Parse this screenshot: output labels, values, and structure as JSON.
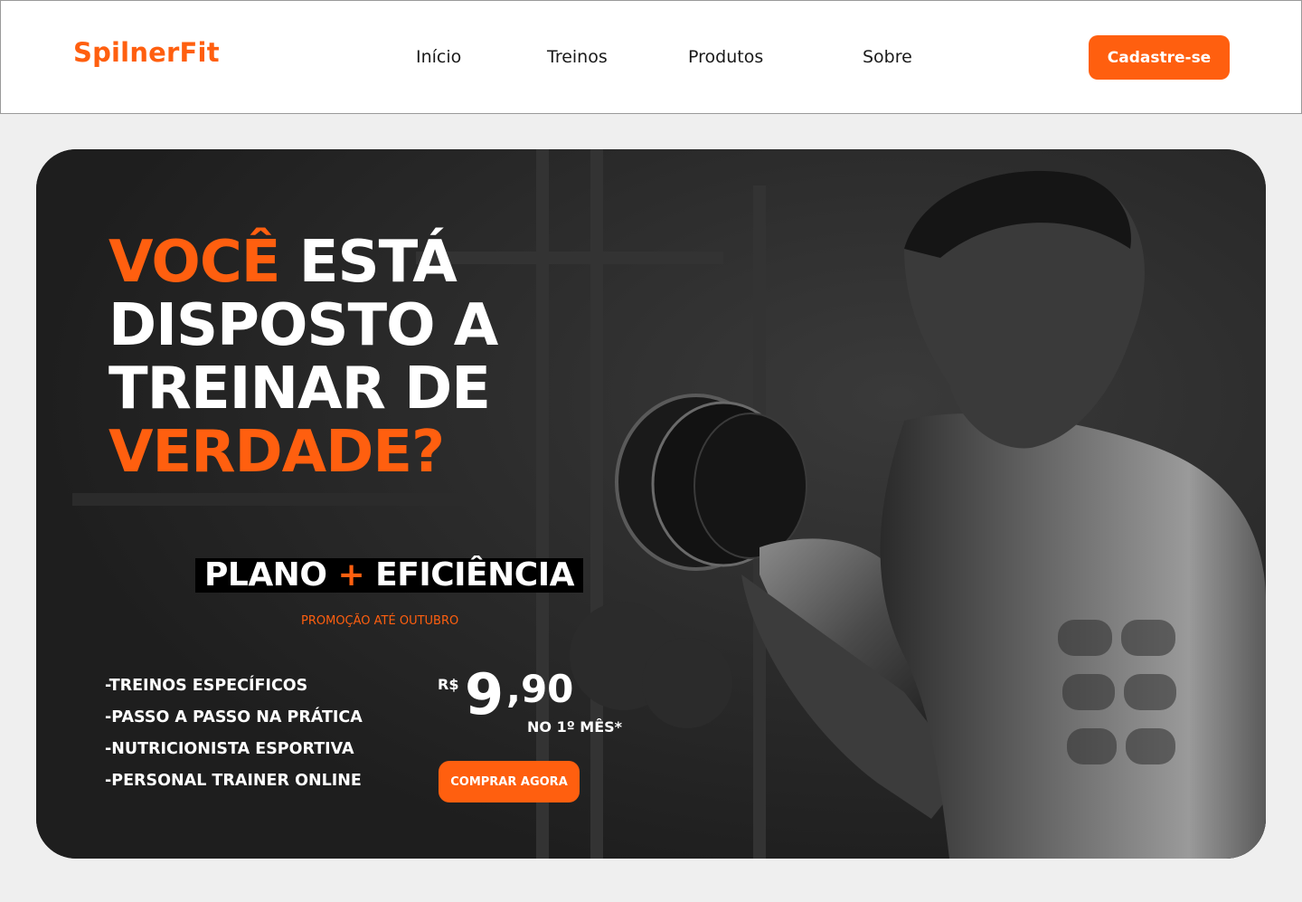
{
  "brand": {
    "logo_text": "SpilnerFit",
    "accent_color": "#ff5f0f"
  },
  "nav": {
    "items": [
      {
        "label": "Início"
      },
      {
        "label": "Treinos"
      },
      {
        "label": "Produtos"
      },
      {
        "label": "Sobre"
      }
    ],
    "signup_label": "Cadastre-se"
  },
  "hero": {
    "headline": {
      "word1": "VOCÊ",
      "word2": " ESTÁ",
      "line2": "DISPOSTO A",
      "line3": "TREINAR DE",
      "line4": "VERDADE?"
    },
    "plan": {
      "part1": "PLANO ",
      "plus": "+",
      "part2": " EFICIÊNCIA"
    },
    "promo": "PROMOÇÃO ATÉ OUTUBRO",
    "features": [
      "-TREINOS ESPECÍFICOS",
      "-PASSO A PASSO NA PRÁTICA",
      "-NUTRICIONISTA ESPORTIVA",
      "-PERSONAL TRAINER ONLINE"
    ],
    "price": {
      "currency": "R$",
      "integer": "9",
      "decimal": ",90",
      "note": "NO 1º MÊS*"
    },
    "buy_label": "COMPRAR AGORA",
    "background_image": "black-and-white gym photo of a man doing a dumbbell curl"
  }
}
